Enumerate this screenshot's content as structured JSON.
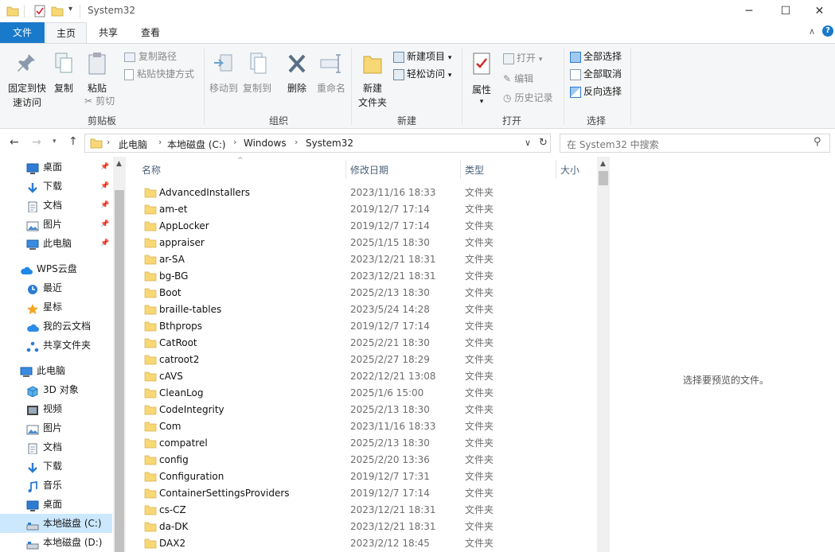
{
  "window": {
    "title": "System32",
    "controls": {
      "minimize": "─",
      "maximize": "☐",
      "close": "✕"
    }
  },
  "tabs": {
    "file": "文件",
    "home": "主页",
    "share": "共享",
    "view": "查看"
  },
  "ribbon": {
    "clipboard": {
      "group": "剪贴板",
      "pin_line1": "固定到快",
      "pin_line2": "速访问",
      "copy": "复制",
      "paste": "粘贴",
      "copy_path": "复制路径",
      "paste_shortcut": "粘贴快捷方式",
      "cut": "剪切"
    },
    "organize": {
      "group": "组织",
      "move_to": "移动到",
      "copy_to": "复制到",
      "delete": "删除",
      "rename": "重命名"
    },
    "new": {
      "group": "新建",
      "new_folder_line1": "新建",
      "new_folder_line2": "文件夹",
      "new_item": "新建项目",
      "easy_access": "轻松访问"
    },
    "open": {
      "group": "打开",
      "properties": "属性",
      "open": "打开",
      "edit": "编辑",
      "history": "历史记录"
    },
    "select": {
      "group": "选择",
      "select_all": "全部选择",
      "select_none": "全部取消",
      "invert": "反向选择"
    }
  },
  "address": {
    "crumbs": [
      "此电脑",
      "本地磁盘 (C:)",
      "Windows",
      "System32"
    ],
    "search_placeholder": "在 System32 中搜索"
  },
  "nav": {
    "quick": [
      {
        "label": "桌面",
        "icon": "desktop-icon"
      },
      {
        "label": "下载",
        "icon": "download-icon"
      },
      {
        "label": "文档",
        "icon": "document-icon"
      },
      {
        "label": "图片",
        "icon": "picture-icon"
      },
      {
        "label": "此电脑",
        "icon": "computer-icon"
      }
    ],
    "wps_root": "WPS云盘",
    "wps": [
      {
        "label": "最近",
        "icon": "recent-icon"
      },
      {
        "label": "星标",
        "icon": "star-icon"
      },
      {
        "label": "我的云文档",
        "icon": "cloud-icon"
      },
      {
        "label": "共享文件夹",
        "icon": "share-icon"
      }
    ],
    "pc_root": "此电脑",
    "pc": [
      {
        "label": "3D 对象",
        "icon": "cube-icon"
      },
      {
        "label": "视频",
        "icon": "video-icon"
      },
      {
        "label": "图片",
        "icon": "picture-icon"
      },
      {
        "label": "文档",
        "icon": "document-icon"
      },
      {
        "label": "下载",
        "icon": "download-icon"
      },
      {
        "label": "音乐",
        "icon": "music-icon"
      },
      {
        "label": "桌面",
        "icon": "desktop-icon"
      },
      {
        "label": "本地磁盘 (C:)",
        "icon": "drive-icon"
      },
      {
        "label": "本地磁盘 (D:)",
        "icon": "drive-icon"
      }
    ]
  },
  "columns": {
    "name": "名称",
    "date": "修改日期",
    "type": "类型",
    "size": "大小"
  },
  "files": [
    {
      "name": "AdvancedInstallers",
      "date": "2023/11/16 18:33",
      "type": "文件夹"
    },
    {
      "name": "am-et",
      "date": "2019/12/7 17:14",
      "type": "文件夹"
    },
    {
      "name": "AppLocker",
      "date": "2019/12/7 17:14",
      "type": "文件夹"
    },
    {
      "name": "appraiser",
      "date": "2025/1/15 18:30",
      "type": "文件夹"
    },
    {
      "name": "ar-SA",
      "date": "2023/12/21 18:31",
      "type": "文件夹"
    },
    {
      "name": "bg-BG",
      "date": "2023/12/21 18:31",
      "type": "文件夹"
    },
    {
      "name": "Boot",
      "date": "2025/2/13 18:30",
      "type": "文件夹"
    },
    {
      "name": "braille-tables",
      "date": "2023/5/24 14:28",
      "type": "文件夹"
    },
    {
      "name": "Bthprops",
      "date": "2019/12/7 17:14",
      "type": "文件夹"
    },
    {
      "name": "CatRoot",
      "date": "2025/2/21 18:30",
      "type": "文件夹"
    },
    {
      "name": "catroot2",
      "date": "2025/2/27 18:29",
      "type": "文件夹"
    },
    {
      "name": "cAVS",
      "date": "2022/12/21 13:08",
      "type": "文件夹"
    },
    {
      "name": "CleanLog",
      "date": "2025/1/6 15:00",
      "type": "文件夹"
    },
    {
      "name": "CodeIntegrity",
      "date": "2025/2/13 18:30",
      "type": "文件夹"
    },
    {
      "name": "Com",
      "date": "2023/11/16 18:33",
      "type": "文件夹"
    },
    {
      "name": "compatrel",
      "date": "2025/2/13 18:30",
      "type": "文件夹"
    },
    {
      "name": "config",
      "date": "2025/2/20 13:36",
      "type": "文件夹"
    },
    {
      "name": "Configuration",
      "date": "2019/12/7 17:31",
      "type": "文件夹"
    },
    {
      "name": "ContainerSettingsProviders",
      "date": "2019/12/7 17:14",
      "type": "文件夹"
    },
    {
      "name": "cs-CZ",
      "date": "2023/12/21 18:31",
      "type": "文件夹"
    },
    {
      "name": "da-DK",
      "date": "2023/12/21 18:31",
      "type": "文件夹"
    },
    {
      "name": "DAX2",
      "date": "2023/2/12 18:45",
      "type": "文件夹"
    }
  ],
  "preview": {
    "empty_text": "选择要预览的文件。"
  },
  "colors": {
    "accent": "#1979ca",
    "folder": "#f8d775",
    "selected_nav": "#cce8ff"
  }
}
